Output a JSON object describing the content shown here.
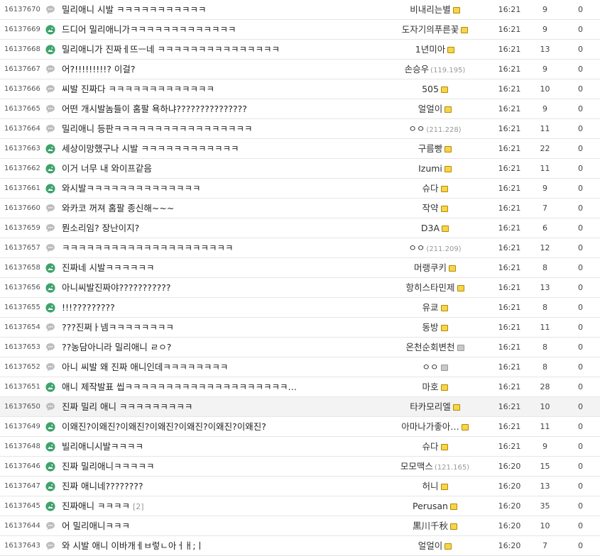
{
  "icons": {
    "chat": "speech-bubble-icon",
    "image": "image-icon",
    "lock": "fixed-nick-icon"
  },
  "colors": {
    "chat_icon": "#bdbdbd",
    "image_icon": "#3da36b",
    "lock_fill": "#f7d54a",
    "row_border": "#e6e6e6",
    "highlight_row": "#f3f3f3"
  },
  "rows": [
    {
      "no": "16137670",
      "type": "chat",
      "title": "밀리애니 시발 ㅋㅋㅋㅋㅋㅋㅋㅋㅋㅋㅋ",
      "reply": "",
      "writer": "비내리는별",
      "ip": "",
      "lock": "gold",
      "time": "16:21",
      "views": "9",
      "recom": "0",
      "hl": false
    },
    {
      "no": "16137669",
      "type": "image",
      "title": "드디어 밀리애니가ㅋㅋㅋㅋㅋㅋㅋㅋㅋㅋㅋㅋㅋ",
      "reply": "",
      "writer": "도자기의푸른꽃",
      "ip": "",
      "lock": "gold",
      "time": "16:21",
      "views": "9",
      "recom": "0",
      "hl": false
    },
    {
      "no": "16137668",
      "type": "image",
      "title": "밀리애니가 진짜ㅔ뜨ㅡ네 ㅋㅋㅋㅋㅋㅋㅋㅋㅋㅋㅋㅋㅋㅋㅋ",
      "reply": "",
      "writer": "1년미아",
      "ip": "",
      "lock": "gold",
      "time": "16:21",
      "views": "13",
      "recom": "0",
      "hl": false
    },
    {
      "no": "16137667",
      "type": "chat",
      "title": "어?!!!!!!!!!? 이걸?",
      "reply": "",
      "writer": "손승우",
      "ip": "(119.195)",
      "lock": "",
      "time": "16:21",
      "views": "9",
      "recom": "0",
      "hl": false
    },
    {
      "no": "16137666",
      "type": "chat",
      "title": "씨발 진짜다 ㅋㅋㅋㅋㅋㅋㅋㅋㅋㅋㅋㅋㅋ",
      "reply": "",
      "writer": "505",
      "ip": "",
      "lock": "gold",
      "time": "16:21",
      "views": "10",
      "recom": "0",
      "hl": false
    },
    {
      "no": "16137665",
      "type": "chat",
      "title": "어떤 개시발놈들이 홈팔 욕하냐???????????????",
      "reply": "",
      "writer": "얼얼이",
      "ip": "",
      "lock": "gold",
      "time": "16:21",
      "views": "9",
      "recom": "0",
      "hl": false
    },
    {
      "no": "16137664",
      "type": "chat",
      "title": "밀리애니 등판ㅋㅋㅋㅋㅋㅋㅋㅋㅋㅋㅋㅋㅋㅋㅋㅋㅋ",
      "reply": "",
      "writer": "ㅇㅇ",
      "ip": "(211.228)",
      "lock": "",
      "time": "16:21",
      "views": "11",
      "recom": "0",
      "hl": false
    },
    {
      "no": "16137663",
      "type": "image",
      "title": "세상이망했구나 시발 ㅋㅋㅋㅋㅋㅋㅋㅋㅋㅋㅋㅋ",
      "reply": "",
      "writer": "구름빵",
      "ip": "",
      "lock": "gold",
      "time": "16:21",
      "views": "22",
      "recom": "0",
      "hl": false
    },
    {
      "no": "16137662",
      "type": "image",
      "title": "이거 너무 내 와이프같음",
      "reply": "",
      "writer": "Izumi",
      "ip": "",
      "lock": "gold",
      "time": "16:21",
      "views": "11",
      "recom": "0",
      "hl": false
    },
    {
      "no": "16137661",
      "type": "image",
      "title": "와시발ㅋㅋㅋㅋㅋㅋㅋㅋㅋㅋㅋㅋㅋㅋ",
      "reply": "",
      "writer": "슈다",
      "ip": "",
      "lock": "gold",
      "time": "16:21",
      "views": "9",
      "recom": "0",
      "hl": false
    },
    {
      "no": "16137660",
      "type": "chat",
      "title": "와카코 꺼져 홈팔 종신해~~~",
      "reply": "",
      "writer": "작약",
      "ip": "",
      "lock": "gold",
      "time": "16:21",
      "views": "7",
      "recom": "0",
      "hl": false
    },
    {
      "no": "16137659",
      "type": "chat",
      "title": "뭔소리임? 장난이지?",
      "reply": "",
      "writer": "D3A",
      "ip": "",
      "lock": "gold",
      "time": "16:21",
      "views": "6",
      "recom": "0",
      "hl": false
    },
    {
      "no": "16137657",
      "type": "chat",
      "title": "ㅋㅋㅋㅋㅋㅋㅋㅋㅋㅋㅋㅋㅋㅋㅋㅋㅋㅋㅋㅋㅋ",
      "reply": "",
      "writer": "ㅇㅇ",
      "ip": "(211.209)",
      "lock": "",
      "time": "16:21",
      "views": "12",
      "recom": "0",
      "hl": false
    },
    {
      "no": "16137658",
      "type": "image",
      "title": "진짜네 시발ㅋㅋㅋㅋㅋㅋ",
      "reply": "",
      "writer": "머랭쿠키",
      "ip": "",
      "lock": "gold",
      "time": "16:21",
      "views": "8",
      "recom": "0",
      "hl": false
    },
    {
      "no": "16137656",
      "type": "image",
      "title": "아니씨발진짜야???????????",
      "reply": "",
      "writer": "항히스타민제",
      "ip": "",
      "lock": "gold",
      "time": "16:21",
      "views": "13",
      "recom": "0",
      "hl": false
    },
    {
      "no": "16137655",
      "type": "image",
      "title": "!!!?????????",
      "reply": "",
      "writer": "유쿄",
      "ip": "",
      "lock": "gold",
      "time": "16:21",
      "views": "8",
      "recom": "0",
      "hl": false
    },
    {
      "no": "16137654",
      "type": "chat",
      "title": "???진쩌ㅏ넴ㅋㅋㅋㅋㅋㅋㅋㅋ",
      "reply": "",
      "writer": "동방",
      "ip": "",
      "lock": "gold",
      "time": "16:21",
      "views": "11",
      "recom": "0",
      "hl": false
    },
    {
      "no": "16137653",
      "type": "chat",
      "title": "??농담아니라 밀리애니 ㄹㅇ?",
      "reply": "",
      "writer": "온천순회변천",
      "ip": "",
      "lock": "gray",
      "time": "16:21",
      "views": "8",
      "recom": "0",
      "hl": false
    },
    {
      "no": "16137652",
      "type": "chat",
      "title": "아니 씨발 왜 진짜 애니인데ㅋㅋㅋㅋㅋㅋㅋㅋ",
      "reply": "",
      "writer": "ㅇㅇ",
      "ip": "",
      "lock": "gray",
      "time": "16:21",
      "views": "8",
      "recom": "0",
      "hl": false
    },
    {
      "no": "16137651",
      "type": "image",
      "title": "애니 제작발표 씹ㅋㅋㅋㅋㅋㅋㅋㅋㅋㅋㅋㅋㅋㅋㅋㅋㅋㅋㅋㅋ…",
      "reply": "",
      "writer": "마호",
      "ip": "",
      "lock": "gold",
      "time": "16:21",
      "views": "28",
      "recom": "0",
      "hl": false
    },
    {
      "no": "16137650",
      "type": "chat",
      "title": "진짜 밀리 애니 ㅋㅋㅋㅋㅋㅋㅋㅋㅋ",
      "reply": "",
      "writer": "타카모리엘",
      "ip": "",
      "lock": "gold",
      "time": "16:21",
      "views": "10",
      "recom": "0",
      "hl": true
    },
    {
      "no": "16137649",
      "type": "image",
      "title": "이왜진?이왜진?이왜진?이왜진?이왜진?이왜진?이왜진?",
      "reply": "",
      "writer": "아마나가좋아…",
      "ip": "",
      "lock": "gold",
      "time": "16:21",
      "views": "11",
      "recom": "0",
      "hl": false
    },
    {
      "no": "16137648",
      "type": "image",
      "title": "빌리애니시발ㅋㅋㅋㅋ",
      "reply": "",
      "writer": "슈다",
      "ip": "",
      "lock": "gold",
      "time": "16:21",
      "views": "9",
      "recom": "0",
      "hl": false
    },
    {
      "no": "16137646",
      "type": "image",
      "title": "진짜 밀리애니ㅋㅋㅋㅋㅋ",
      "reply": "",
      "writer": "모모맥스",
      "ip": "(121.165)",
      "lock": "",
      "time": "16:20",
      "views": "15",
      "recom": "0",
      "hl": false
    },
    {
      "no": "16137647",
      "type": "image",
      "title": "진짜 애니네????????",
      "reply": "",
      "writer": "허니",
      "ip": "",
      "lock": "gold",
      "time": "16:20",
      "views": "13",
      "recom": "0",
      "hl": false
    },
    {
      "no": "16137645",
      "type": "image",
      "title": "진짜애니 ㅋㅋㅋㅋ",
      "reply": "[2]",
      "writer": "Perusan",
      "ip": "",
      "lock": "gold",
      "time": "16:20",
      "views": "35",
      "recom": "0",
      "hl": false
    },
    {
      "no": "16137644",
      "type": "chat",
      "title": "어 밀리애니ㅋㅋㅋ",
      "reply": "",
      "writer": "黒川千秋",
      "ip": "",
      "lock": "gold",
      "time": "16:20",
      "views": "10",
      "recom": "0",
      "hl": false
    },
    {
      "no": "16137643",
      "type": "chat",
      "title": "와 시발 애니 이바개ㅔㅂ렇ㄴ아ㅓㅐ;ㅣ",
      "reply": "",
      "writer": "얼얼이",
      "ip": "",
      "lock": "gold",
      "time": "16:20",
      "views": "7",
      "recom": "0",
      "hl": false
    }
  ]
}
